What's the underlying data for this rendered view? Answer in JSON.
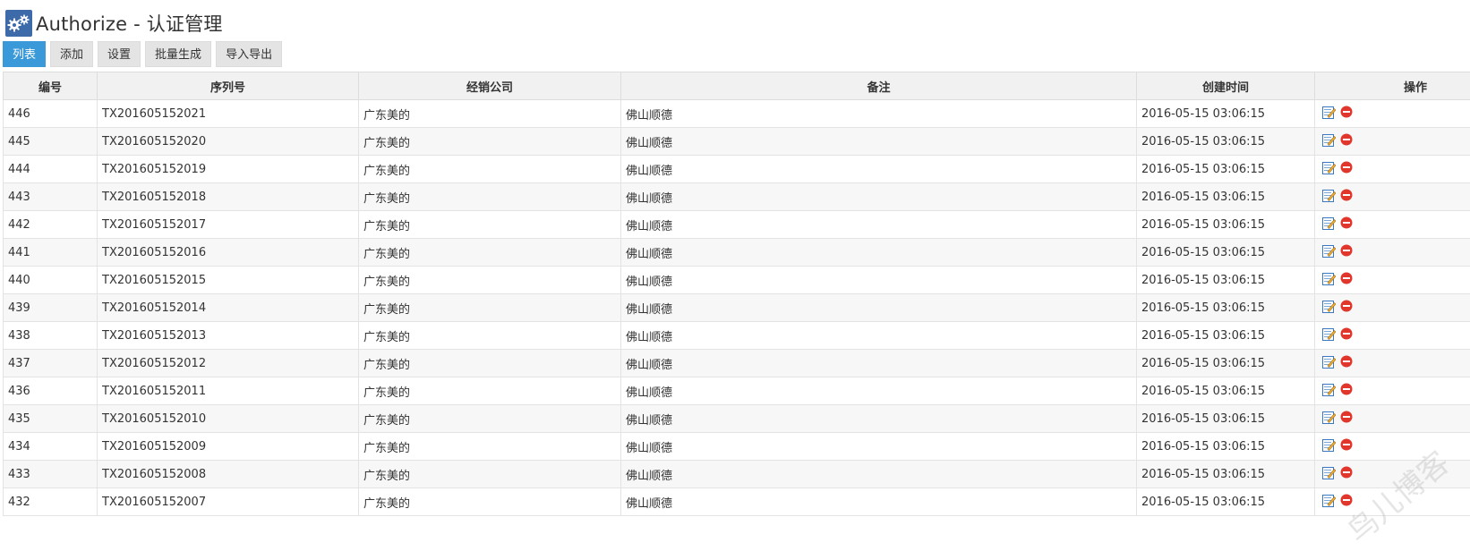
{
  "header": {
    "title": "Authorize - 认证管理",
    "icon": "gears-icon"
  },
  "toolbar": {
    "tabs": [
      {
        "label": "列表",
        "active": true
      },
      {
        "label": "添加",
        "active": false
      },
      {
        "label": "设置",
        "active": false
      },
      {
        "label": "批量生成",
        "active": false
      },
      {
        "label": "导入导出",
        "active": false
      }
    ]
  },
  "table": {
    "columns": [
      "编号",
      "序列号",
      "经销公司",
      "备注",
      "创建时间",
      "操作"
    ],
    "rows": [
      [
        "446",
        "TX201605152021",
        "广东美的",
        "佛山顺德",
        "2016-05-15 03:06:15"
      ],
      [
        "445",
        "TX201605152020",
        "广东美的",
        "佛山顺德",
        "2016-05-15 03:06:15"
      ],
      [
        "444",
        "TX201605152019",
        "广东美的",
        "佛山顺德",
        "2016-05-15 03:06:15"
      ],
      [
        "443",
        "TX201605152018",
        "广东美的",
        "佛山顺德",
        "2016-05-15 03:06:15"
      ],
      [
        "442",
        "TX201605152017",
        "广东美的",
        "佛山顺德",
        "2016-05-15 03:06:15"
      ],
      [
        "441",
        "TX201605152016",
        "广东美的",
        "佛山顺德",
        "2016-05-15 03:06:15"
      ],
      [
        "440",
        "TX201605152015",
        "广东美的",
        "佛山顺德",
        "2016-05-15 03:06:15"
      ],
      [
        "439",
        "TX201605152014",
        "广东美的",
        "佛山顺德",
        "2016-05-15 03:06:15"
      ],
      [
        "438",
        "TX201605152013",
        "广东美的",
        "佛山顺德",
        "2016-05-15 03:06:15"
      ],
      [
        "437",
        "TX201605152012",
        "广东美的",
        "佛山顺德",
        "2016-05-15 03:06:15"
      ],
      [
        "436",
        "TX201605152011",
        "广东美的",
        "佛山顺德",
        "2016-05-15 03:06:15"
      ],
      [
        "435",
        "TX201605152010",
        "广东美的",
        "佛山顺德",
        "2016-05-15 03:06:15"
      ],
      [
        "434",
        "TX201605152009",
        "广东美的",
        "佛山顺德",
        "2016-05-15 03:06:15"
      ],
      [
        "433",
        "TX201605152008",
        "广东美的",
        "佛山顺德",
        "2016-05-15 03:06:15"
      ],
      [
        "432",
        "TX201605152007",
        "广东美的",
        "佛山顺德",
        "2016-05-15 03:06:15"
      ]
    ],
    "row_actions": [
      "edit-icon",
      "delete-icon"
    ]
  },
  "watermark": "鸟儿博客",
  "colors": {
    "active_tab": "#3a99d8",
    "icon_bg": "#3d6aa9",
    "delete": "#e0362c"
  }
}
